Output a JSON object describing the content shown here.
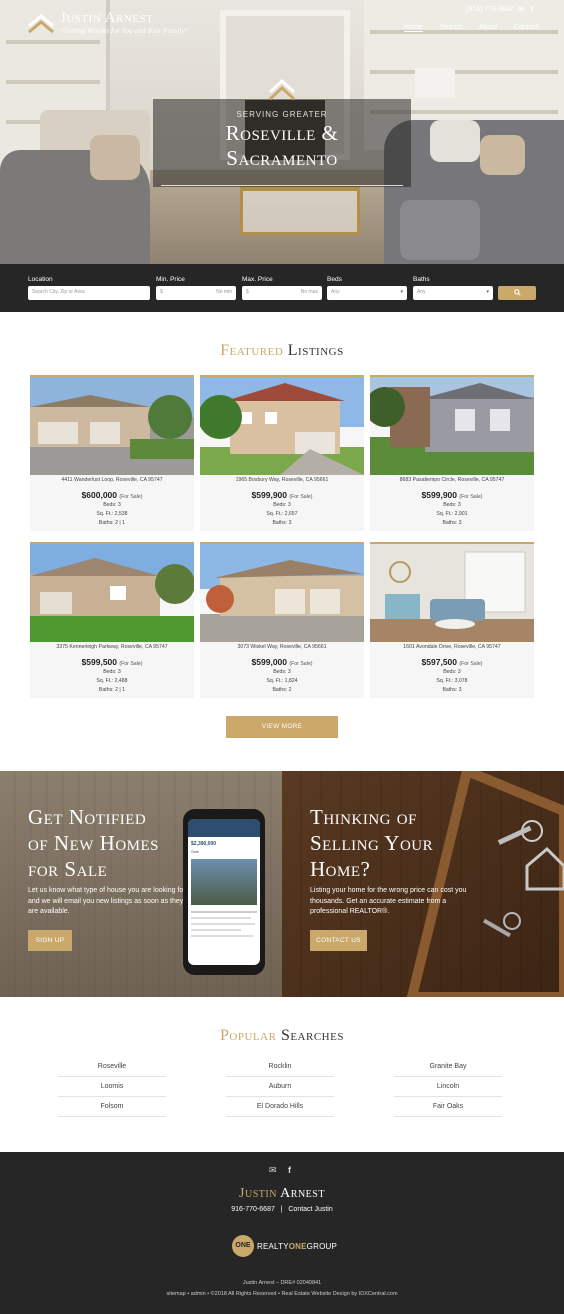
{
  "brand": {
    "name": "Justin Arnest",
    "tagline": "\"Getting Results for You and Your Family\""
  },
  "header": {
    "phone": "(916) 770-6687",
    "icons": [
      "envelope-icon",
      "facebook-icon"
    ],
    "nav": [
      "Home",
      "Search",
      "About",
      "Contact"
    ],
    "active_nav": "Home"
  },
  "hero": {
    "subtitle": "SERVING GREATER",
    "title_line1": "Roseville &",
    "title_line2": "Sacramento"
  },
  "search": {
    "location_label": "Location",
    "location_placeholder": "Search City, Zip or Area",
    "min_label": "Min. Price",
    "min_prefix": "$",
    "min_placeholder": "No min",
    "max_label": "Max. Price",
    "max_prefix": "$",
    "max_placeholder": "No max",
    "beds_label": "Beds",
    "beds_value": "Any",
    "baths_label": "Baths",
    "baths_value": "Any",
    "button_icon": "search-icon"
  },
  "featured": {
    "title_gold": "Featured",
    "title_dark": "Listings",
    "for_sale": "(For Sale)",
    "listings": [
      {
        "address": "4411 Wanderlust Loop, Roseville, CA 95747",
        "price": "$600,000",
        "beds": "Beds: 3",
        "sqft": "Sq. Ft.: 2,538",
        "baths": "Baths: 2 | 1"
      },
      {
        "address": "1965 Bosbury Way, Roseville, CA 95661",
        "price": "$599,900",
        "beds": "Beds: 3",
        "sqft": "Sq. Ft.: 2,657",
        "baths": "Baths: 3"
      },
      {
        "address": "8683 Pasatiempo Circle, Roseville, CA 95747",
        "price": "$599,900",
        "beds": "Beds: 3",
        "sqft": "Sq. Ft.: 2,901",
        "baths": "Baths: 3"
      },
      {
        "address": "3375 Kennerleigh Parkway, Roseville, CA 95747",
        "price": "$599,500",
        "beds": "Beds: 3",
        "sqft": "Sq. Ft.: 2,488",
        "baths": "Baths: 2 | 1"
      },
      {
        "address": "3073 Wiskel Way, Roseville, CA 95661",
        "price": "$599,000",
        "beds": "Beds: 3",
        "sqft": "Sq. Ft.: 1,824",
        "baths": "Baths: 2"
      },
      {
        "address": "1601 Avondale Drive, Roseville, CA 95747",
        "price": "$597,500",
        "beds": "Beds: 3",
        "sqft": "Sq. Ft.: 3,078",
        "baths": "Baths: 3"
      }
    ],
    "view_more": "VIEW MORE"
  },
  "cta": {
    "left_title": [
      "Get Notified",
      "of New Homes",
      "for Sale"
    ],
    "left_text": "Let us know what type of house you are looking for and we will email you new listings as soon as they are available.",
    "left_button": "SIGN UP",
    "right_title": [
      "Thinking of",
      "Selling Your",
      "Home?"
    ],
    "right_text": "Listing your home for the wrong price can cost you thousands. Get an accurate estimate from a professional REALTOR®.",
    "right_button": "CONTACT US",
    "phone_price": "$2,390,000",
    "phone_status": "Sale"
  },
  "popular": {
    "title_gold": "Popular",
    "title_dark": "Searches",
    "items": [
      "Roseville",
      "Rocklin",
      "Granite Bay",
      "Loomis",
      "Auburn",
      "Lincoln",
      "Folsom",
      "El Dorado Hills",
      "Fair Oaks"
    ]
  },
  "footer": {
    "icons": [
      "envelope-icon",
      "facebook-icon"
    ],
    "name_gold": "Justin",
    "name_white": "Arnest",
    "phone": "916-770-6687",
    "separator": "|",
    "contact": "Contact Justin",
    "brokerage_badge": "ONE",
    "brokerage_a": "REALTY",
    "brokerage_b": "ONE",
    "brokerage_c": "GROUP",
    "license": "Justin Arnest – DRE# 02040841",
    "links": "sitemap  •  admin  •  ©2018 All Rights Reserved  •  Real Estate Website Design by IDXCentral.com"
  },
  "colors": {
    "accent_gold": "#c9a86a",
    "dark_bg": "#262626"
  }
}
